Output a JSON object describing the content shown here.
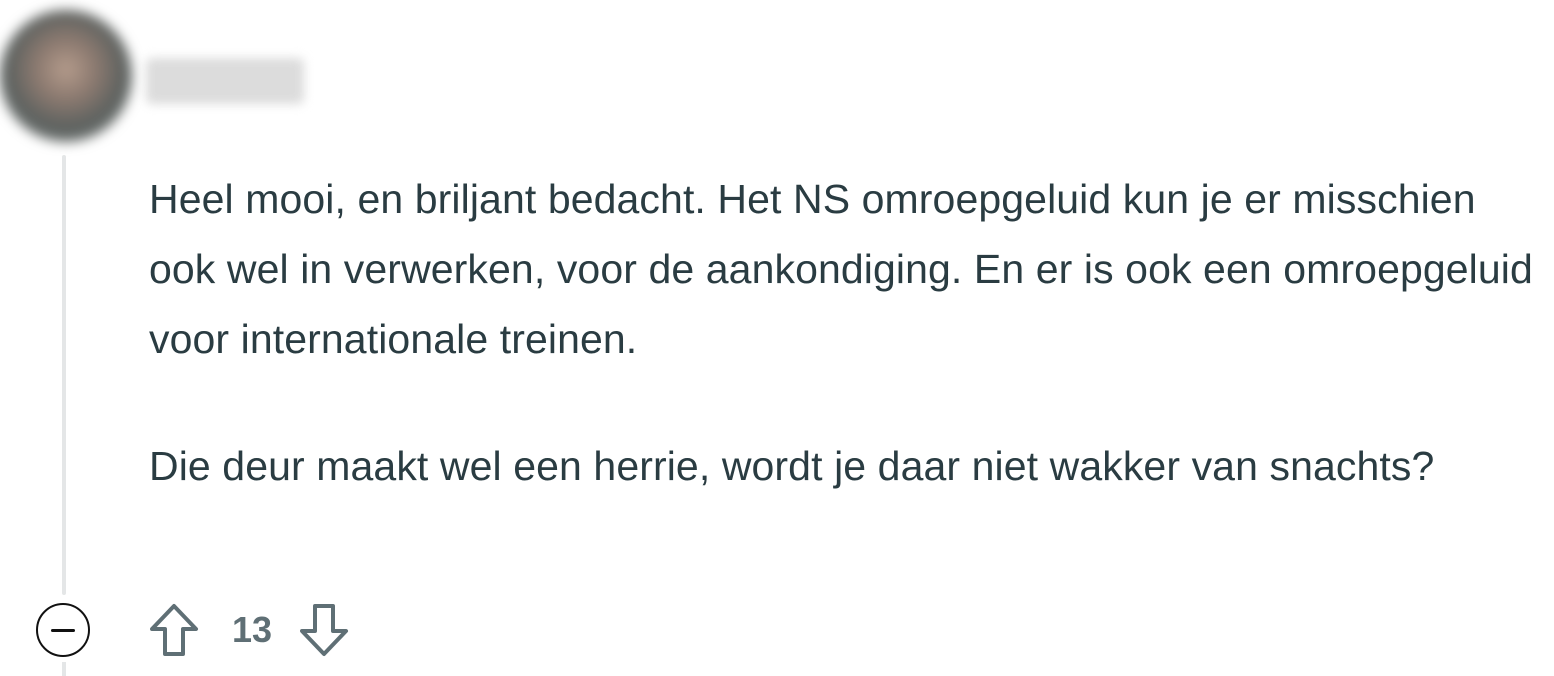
{
  "comment": {
    "author": {
      "username": "",
      "avatar_icon": "user-avatar-blurred"
    },
    "paragraphs": [
      "Heel mooi, en briljant bedacht. Het NS omroepgeluid kun je er misschien ook wel in verwerken, voor de aankondiging. En er is ook een omroepgeluid voor internationale treinen.",
      "Die deur maakt wel een herrie, wordt je daar niet wakker van snachts?"
    ],
    "actions": {
      "collapse_icon": "minus-circle-icon",
      "upvote_icon": "arrow-up-outline-icon",
      "downvote_icon": "arrow-down-outline-icon",
      "score": "13"
    }
  },
  "colors": {
    "text": "#2a3c42",
    "thread_line": "#e4e6e7",
    "vote_text": "#5f6f75",
    "icon_stroke": "#5f6f75"
  }
}
